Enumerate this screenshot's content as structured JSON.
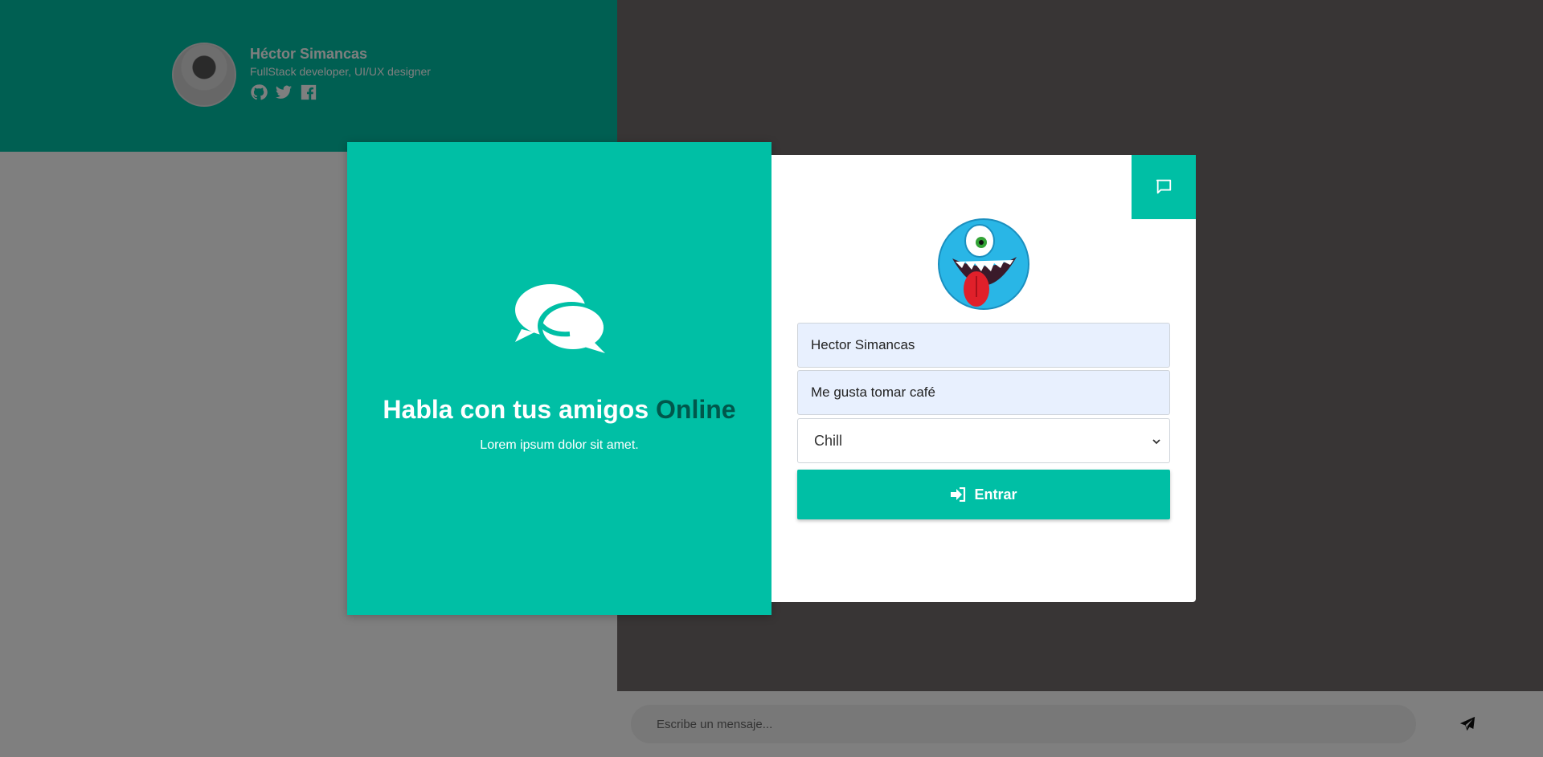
{
  "profile": {
    "name": "Héctor Simancas",
    "role": "FullStack developer, UI/UX designer",
    "social_icons": [
      "github-icon",
      "twitter-icon",
      "facebook-icon"
    ]
  },
  "composer": {
    "placeholder": "Escribe un mensaje...",
    "send_icon": "paper-plane-icon"
  },
  "modal": {
    "title_main": "Habla con tus amigos",
    "title_accent": "Online",
    "subtitle": "Lorem ipsum dolor sit amet.",
    "corner_icon": "chat-icon",
    "name_value": "Hector Simancas",
    "status_value": "Me gusta tomar café",
    "mood_selected": "Chill",
    "enter_label": "Entrar"
  },
  "colors": {
    "accent": "#00bfa5",
    "accent_dark": "#00574b"
  }
}
